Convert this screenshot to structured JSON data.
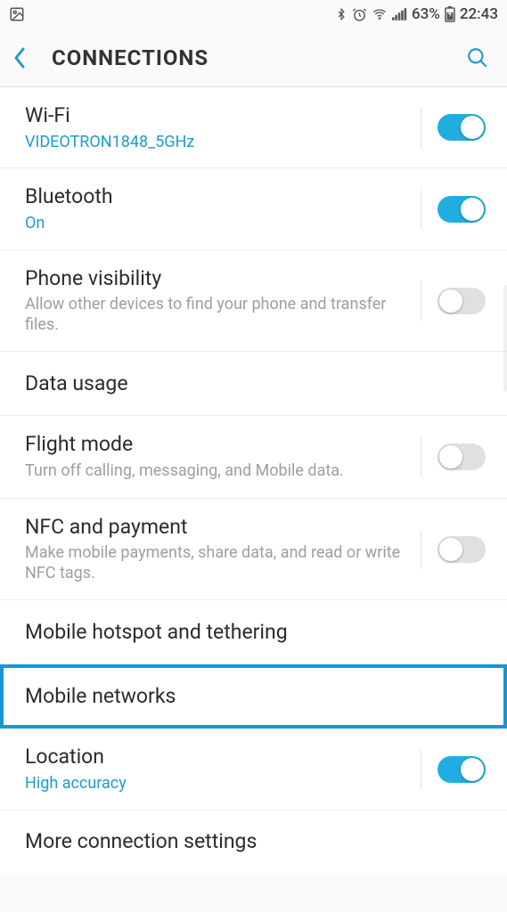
{
  "status": {
    "battery_pct": "63%",
    "time": "22:43"
  },
  "header": {
    "title": "CONNECTIONS"
  },
  "rows": {
    "wifi": {
      "title": "Wi-Fi",
      "sub": "VIDEOTRON1848_5GHz",
      "on": true
    },
    "bluetooth": {
      "title": "Bluetooth",
      "sub": "On",
      "on": true
    },
    "phone_visibility": {
      "title": "Phone visibility",
      "desc": "Allow other devices to find your phone and transfer files.",
      "on": false
    },
    "data_usage": {
      "title": "Data usage"
    },
    "flight_mode": {
      "title": "Flight mode",
      "desc": "Turn off calling, messaging, and Mobile data.",
      "on": false
    },
    "nfc": {
      "title": "NFC and payment",
      "desc": "Make mobile payments, share data, and read or write NFC tags.",
      "on": false
    },
    "hotspot": {
      "title": "Mobile hotspot and tethering"
    },
    "mobile_networks": {
      "title": "Mobile networks"
    },
    "location": {
      "title": "Location",
      "sub": "High accuracy",
      "on": true
    },
    "more": {
      "title": "More connection settings"
    }
  }
}
